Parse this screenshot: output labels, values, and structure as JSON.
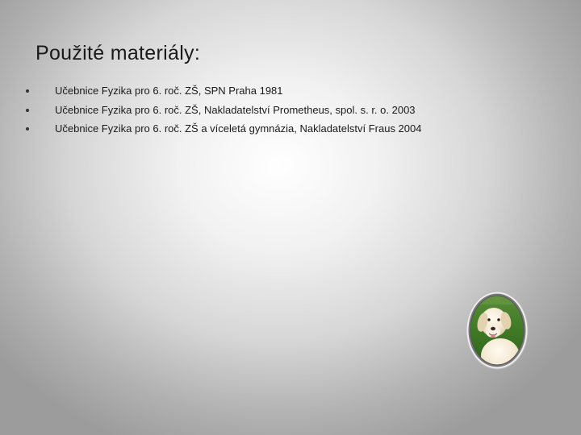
{
  "slide": {
    "title": "Použité materiály:",
    "bullets": [
      "Učebnice Fyzika pro 6. roč. ZŠ, SPN Praha 1981",
      "Učebnice Fyzika pro 6. roč. ZŠ, Nakladatelství Prometheus, spol. s. r. o. 2003",
      "Učebnice Fyzika pro 6. roč. ZŠ a víceletá gymnázia, Nakladatelství Fraus 2004"
    ],
    "photo": {
      "icon": "dog-photo-icon",
      "frame_color": "#e8e8e8",
      "grass_color": "#3f7a25"
    }
  }
}
